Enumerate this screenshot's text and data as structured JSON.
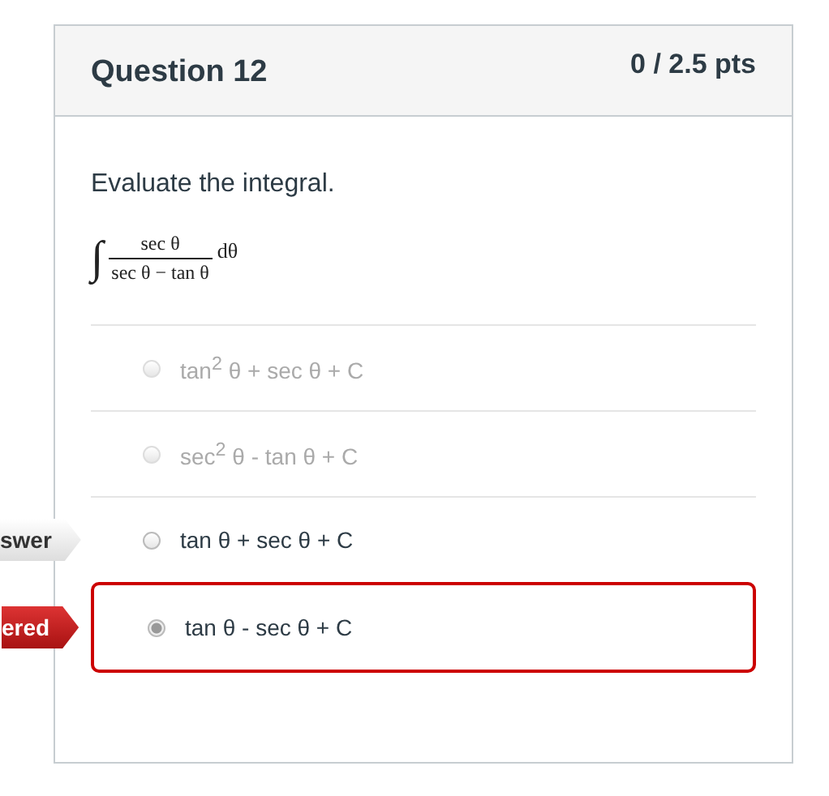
{
  "question": {
    "title": "Question 12",
    "points": "0 / 2.5 pts"
  },
  "prompt": "Evaluate the integral.",
  "integral": {
    "sign": "∫",
    "numerator": "sec θ",
    "denominator": "sec θ − tan θ",
    "differential": "dθ"
  },
  "options": [
    {
      "text": "tan$^{2}$ θ + sec θ + C",
      "disabled": true,
      "selected": false
    },
    {
      "text": "sec$^{2}$ θ - tan θ + C",
      "disabled": true,
      "selected": false
    },
    {
      "text": "tan θ + sec θ + C",
      "disabled": false,
      "selected": false,
      "flag": {
        "kind": "correct",
        "text": "swer"
      }
    },
    {
      "text": "tan θ - sec θ + C",
      "disabled": false,
      "selected": true,
      "flag": {
        "kind": "answered",
        "text": "ered"
      }
    }
  ]
}
